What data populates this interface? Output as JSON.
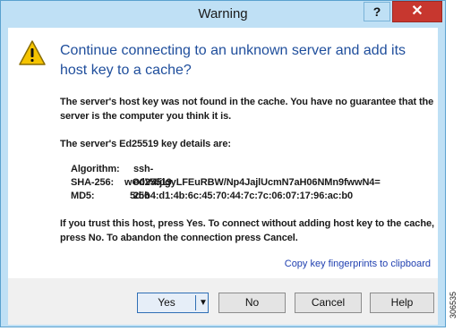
{
  "window": {
    "title": "Warning"
  },
  "titlebar": {
    "help_label": "?",
    "close_label": "✕"
  },
  "dialog": {
    "heading": "Continue connecting to an unknown server and add its host key to a cache?",
    "paragraph1": "The server's host key was not found in the cache. You have no guarantee that the server is the computer you think it is.",
    "paragraph2": "The server's Ed25519 key details are:",
    "key_details": [
      {
        "label": "Algorithm:",
        "value": "ssh-ed25519 256"
      },
      {
        "label": "SHA-256:",
        "value": "wO0V4/jigyLFEuRBW/Np4JajlUcmN7aH06NMn9fwwN4="
      },
      {
        "label": "MD5:",
        "value": "5d:b4:d1:4b:6c:45:70:44:7c:7c:06:07:17:96:ac:b0"
      }
    ],
    "paragraph3": "If you trust this host, press Yes. To connect without adding host key to the cache, press No. To abandon the connection press Cancel.",
    "copy_link": "Copy key fingerprints to clipboard"
  },
  "buttons": {
    "yes": "Yes",
    "yes_dropdown": "▼",
    "no": "No",
    "cancel": "Cancel",
    "help": "Help"
  },
  "figure_id": "306535",
  "colors": {
    "heading": "#1f4e9c",
    "link": "#1f3fb0",
    "close": "#c7372f",
    "titlebar": "#bfe0f5"
  },
  "icons": {
    "warning": "warning-triangle-icon"
  }
}
